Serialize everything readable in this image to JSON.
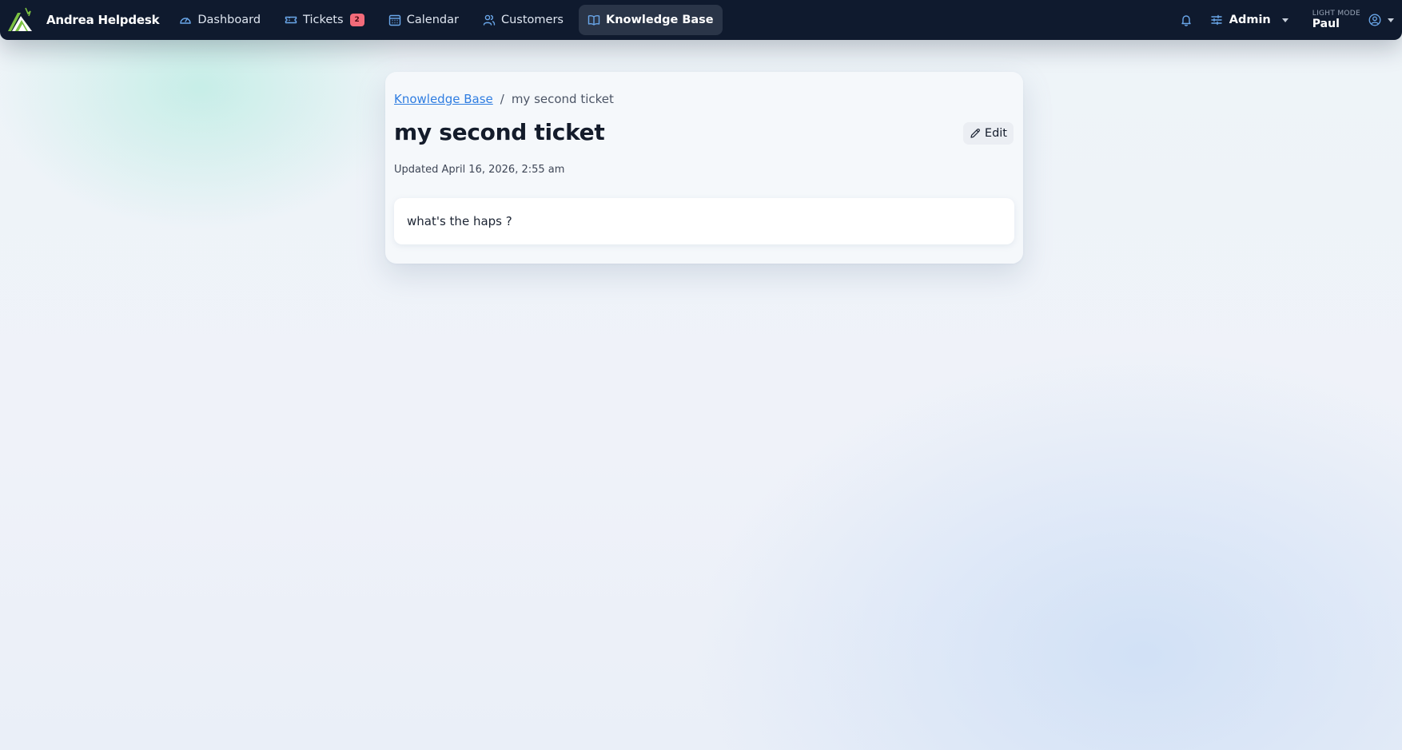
{
  "app": {
    "name": "Andrea Helpdesk"
  },
  "nav": {
    "items": [
      {
        "label": "Dashboard",
        "icon": "dashboard-gauge-icon"
      },
      {
        "label": "Tickets",
        "icon": "ticket-icon",
        "badge": "2"
      },
      {
        "label": "Calendar",
        "icon": "calendar-icon"
      },
      {
        "label": "Customers",
        "icon": "users-icon"
      },
      {
        "label": "Knowledge Base",
        "icon": "book-icon",
        "active": true
      }
    ],
    "admin_label": "Admin",
    "user_mode": "LIGHT MODE",
    "user_name": "Paul"
  },
  "page": {
    "breadcrumb_root": "Knowledge Base",
    "breadcrumb_separator": "/",
    "breadcrumb_current": "my second ticket",
    "title": "my second ticket",
    "edit_label": "Edit",
    "updated": "Updated April 16, 2026, 2:55 am",
    "body": "what's the haps ?"
  },
  "colors": {
    "nav_bg": "#0f1a2e",
    "nav_active_bg": "#2a3548",
    "link": "#2f7de1",
    "badge": "#f36b7a",
    "icon_blue": "#6aa7ea"
  }
}
